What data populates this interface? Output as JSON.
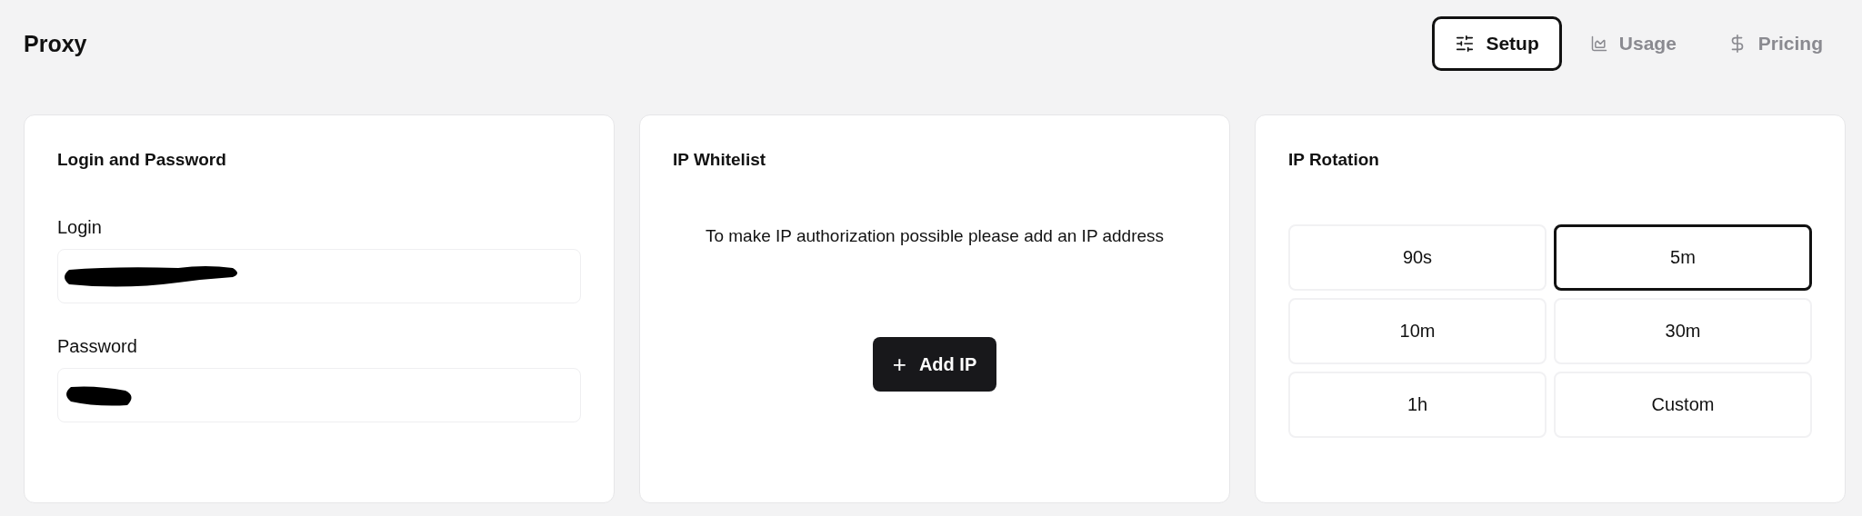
{
  "page": {
    "title": "Proxy"
  },
  "tabs": [
    {
      "label": "Setup",
      "kind": "sliders",
      "selected": true
    },
    {
      "label": "Usage",
      "kind": "chart",
      "selected": false
    },
    {
      "label": "Pricing",
      "kind": "dollar",
      "selected": false
    }
  ],
  "login_card": {
    "title": "Login and Password",
    "fields": [
      {
        "label": "Login",
        "redacted": true,
        "kind": "long"
      },
      {
        "label": "Password",
        "redacted": true,
        "kind": "short"
      }
    ]
  },
  "whitelist_card": {
    "title": "IP Whitelist",
    "message": "To make IP authorization possible please add an IP address",
    "button": {
      "icon": "+",
      "label": "Add IP"
    }
  },
  "rotation_card": {
    "title": "IP Rotation",
    "options": [
      {
        "label": "90s",
        "selected": false
      },
      {
        "label": "5m",
        "selected": true
      },
      {
        "label": "10m",
        "selected": false
      },
      {
        "label": "30m",
        "selected": false
      },
      {
        "label": "1h",
        "selected": false
      },
      {
        "label": "Custom",
        "selected": false
      }
    ]
  }
}
